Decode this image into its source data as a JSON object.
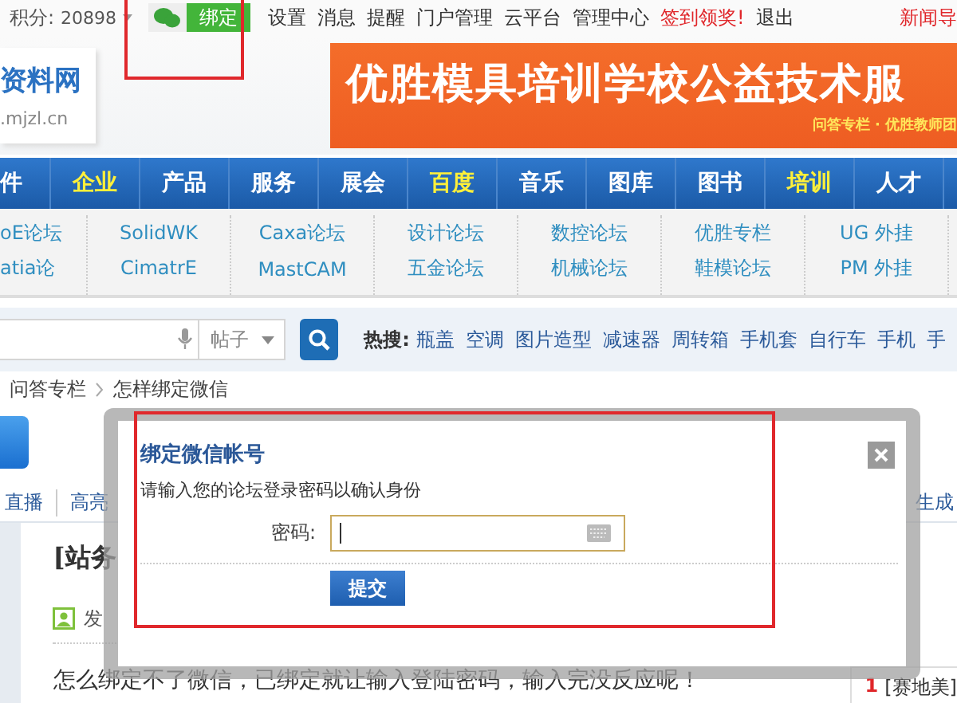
{
  "top_bar": {
    "points_label": "积分:",
    "points": "20898",
    "bind_button": "绑定",
    "links": [
      {
        "text": "设置",
        "highlight": false
      },
      {
        "text": "消息",
        "highlight": false
      },
      {
        "text": "提醒",
        "highlight": false
      },
      {
        "text": "门户管理",
        "highlight": false
      },
      {
        "text": "云平台",
        "highlight": false
      },
      {
        "text": "管理中心",
        "highlight": false
      },
      {
        "text": "签到领奖!",
        "highlight": true
      },
      {
        "text": "退出",
        "highlight": false
      }
    ],
    "news_nav": "新闻导"
  },
  "header": {
    "logo_title": "资料网",
    "logo_url": ".mjzl.cn",
    "banner_title": "优胜模具培训学校公益技术服",
    "banner_subtitle": "问答专栏 · 优胜教师团"
  },
  "nav": [
    {
      "label": "件",
      "highlight": false
    },
    {
      "label": "企业",
      "highlight": true
    },
    {
      "label": "产品",
      "highlight": false
    },
    {
      "label": "服务",
      "highlight": false
    },
    {
      "label": "展会",
      "highlight": false
    },
    {
      "label": "百度",
      "highlight": true
    },
    {
      "label": "音乐",
      "highlight": false
    },
    {
      "label": "图库",
      "highlight": false
    },
    {
      "label": "图书",
      "highlight": false
    },
    {
      "label": "培训",
      "highlight": true
    },
    {
      "label": "人才",
      "highlight": false
    }
  ],
  "sub_nav": [
    {
      "items": [
        "oE论坛",
        "atia论"
      ]
    },
    {
      "items": [
        "SolidWK",
        "CimatrE"
      ]
    },
    {
      "items": [
        "Caxa论坛",
        "MastCAM"
      ]
    },
    {
      "items": [
        "设计论坛",
        "五金论坛"
      ]
    },
    {
      "items": [
        "数控论坛",
        "机械论坛"
      ]
    },
    {
      "items": [
        "优胜专栏",
        "鞋模论坛"
      ]
    },
    {
      "items": [
        "UG 外挂",
        "PM 外挂"
      ]
    }
  ],
  "search": {
    "scope": "帖子",
    "hot_label": "热搜:",
    "hot_terms": [
      "瓶盖",
      "空调",
      "图片造型",
      "减速器",
      "周转箱",
      "手机套",
      "自行车",
      "手机",
      "手"
    ]
  },
  "breadcrumb": [
    "问答专栏",
    "怎样绑定微信"
  ],
  "post": {
    "tabs": [
      "直播",
      "高亮"
    ],
    "tool_link": "生成",
    "title": "[站务",
    "author_label": "发",
    "content": "怎么绑定不了微信，已绑定就让输入登陆密码，输入完没反应呢！",
    "sidebar": [
      {
        "rank": "1",
        "title": "[赛地美]"
      }
    ]
  },
  "dialog": {
    "title": "绑定微信帐号",
    "prompt": "请输入您的论坛登录密码以确认身份",
    "password_label": "密码:",
    "submit": "提交"
  }
}
